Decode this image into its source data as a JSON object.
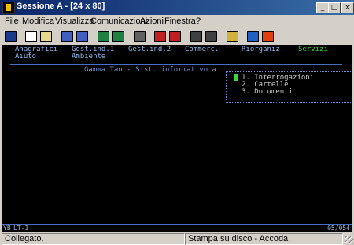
{
  "window": {
    "title": "Sessione A - [24 x 80]"
  },
  "window_controls": {
    "minimize": "_",
    "maximize": "□",
    "close": "×"
  },
  "menu": [
    {
      "label": "File"
    },
    {
      "label": "Modifica"
    },
    {
      "label": "Visualizza"
    },
    {
      "label": "Comunicazioni"
    },
    {
      "label": "Azioni"
    },
    {
      "label": "Finestra"
    },
    {
      "label": "?"
    }
  ],
  "toolbar": {
    "buttons": [
      {
        "icon": "print-screen-icon",
        "color": "#1a3a8a"
      },
      {
        "icon": "copy-icon",
        "color": "#ffffff"
      },
      {
        "icon": "paste-icon",
        "color": "#e8d890"
      },
      {
        "icon": "send-file-icon",
        "color": "#4060c0"
      },
      {
        "icon": "receive-file-icon",
        "color": "#4060c0"
      },
      {
        "icon": "display-setup-icon",
        "color": "#208040"
      },
      {
        "icon": "keyboard-map-icon",
        "color": "#208040"
      },
      {
        "icon": "macro-icon",
        "color": "#606060"
      },
      {
        "icon": "record-macro-icon",
        "color": "#c02020"
      },
      {
        "icon": "stop-macro-icon",
        "color": "#c02020"
      },
      {
        "icon": "play-macro-icon",
        "color": "#404040"
      },
      {
        "icon": "pause-macro-icon",
        "color": "#404040"
      },
      {
        "icon": "clipboard-icon",
        "color": "#d0b040"
      },
      {
        "icon": "globe-icon",
        "color": "#2060c0"
      },
      {
        "icon": "help-icon",
        "color": "#e04010"
      }
    ]
  },
  "terminal": {
    "menu_row1": [
      "Anagrafici",
      "Gest.ind.1",
      "Gest.ind.2",
      "Commerc.",
      "Riorganiz.",
      "Servizi"
    ],
    "menu_row2": [
      "Aiuto",
      "Ambiente"
    ],
    "banner": "Gamma Tau - Sist. informativo a",
    "popup_items": [
      "1. Interrogazioni",
      "2. Cartelle",
      "3. Documenti"
    ]
  },
  "oia": {
    "left": "YB",
    "session": "LT-1",
    "position": "05/054"
  },
  "status": {
    "connection": "Collegato.",
    "print": "Stampa su disco - Accoda"
  }
}
